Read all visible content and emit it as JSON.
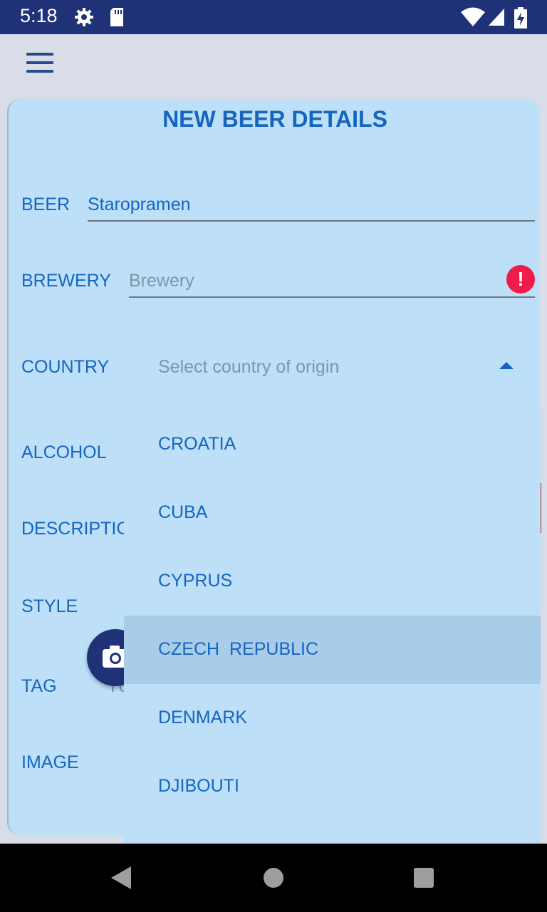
{
  "status_bar": {
    "time": "5:18",
    "icons": [
      "settings-icon",
      "sd-card-icon",
      "wifi-icon",
      "cellular-signal-icon",
      "battery-charging-icon"
    ]
  },
  "app_bar": {
    "menu_icon": "hamburger-menu-icon"
  },
  "form": {
    "title": "NEW BEER DETAILS",
    "beer": {
      "label": "BEER",
      "value": "Staropramen"
    },
    "brewery": {
      "label": "BREWERY",
      "placeholder": "Brewery",
      "error_icon": "error-exclamation-icon"
    },
    "country": {
      "label": "COUNTRY",
      "placeholder": "Select country of origin",
      "caret_icon": "caret-up-icon"
    },
    "alcohol": {
      "label": "ALCOHOL"
    },
    "description": {
      "label": "DESCRIPTIC"
    },
    "style": {
      "label": "STYLE"
    },
    "tag": {
      "label": "TAG",
      "placeholder_partial": "Yc"
    },
    "image": {
      "label": "IMAGE",
      "camera_icon": "camera-icon"
    }
  },
  "country_dropdown": {
    "options": [
      "CROATIA",
      "CUBA",
      "CYPRUS",
      "CZECH  REPUBLIC",
      "DENMARK",
      "DJIBOUTI"
    ],
    "selected_index": 3
  },
  "nav_bar": {
    "icons": [
      "back-icon",
      "home-icon",
      "recents-icon"
    ]
  },
  "colors": {
    "status_bar": "#1f3278",
    "accent": "#1565c0",
    "card_background": "#bde0f8",
    "selected_option": "#a9cde8",
    "error": "#ee1c4a"
  }
}
